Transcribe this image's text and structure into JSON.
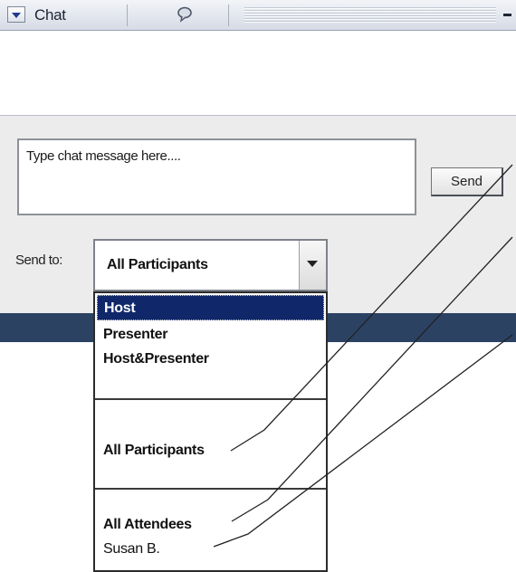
{
  "titlebar": {
    "title": "Chat"
  },
  "compose": {
    "message_placeholder": "Type chat message here....",
    "send_label": "Send",
    "sendto_label": "Send to:",
    "selected_value": "All Participants"
  },
  "dropdown": {
    "options": [
      {
        "label": "Host"
      },
      {
        "label": "Presenter"
      },
      {
        "label": "Host&Presenter"
      },
      {
        "label": "All Participants"
      },
      {
        "label": "All Attendees"
      },
      {
        "label": "Susan B."
      }
    ]
  },
  "icons": {
    "collapse": "chevron-down-icon",
    "bubble": "chat-bubble-icon",
    "minimize": "minimize-icon"
  },
  "colors": {
    "selection": "#10286a",
    "bottom_bar": "#2b4263"
  }
}
